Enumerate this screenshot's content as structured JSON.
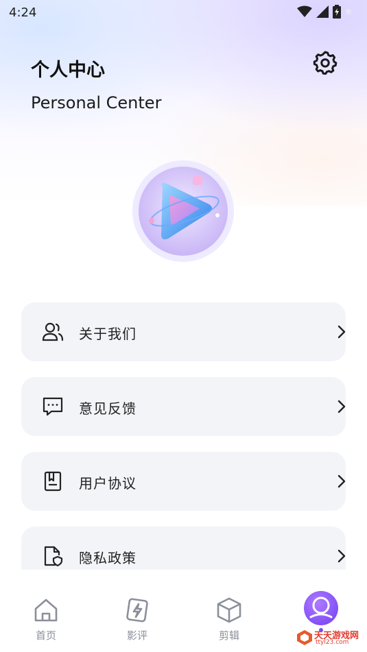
{
  "status_bar": {
    "time": "4:24"
  },
  "header": {
    "title": "个人中心",
    "subtitle": "Personal Center"
  },
  "menu": [
    {
      "label": "关于我们",
      "icon": "users-icon"
    },
    {
      "label": "意见反馈",
      "icon": "feedback-icon"
    },
    {
      "label": "用户协议",
      "icon": "agreement-icon"
    },
    {
      "label": "隐私政策",
      "icon": "privacy-icon"
    }
  ],
  "tabbar": {
    "items": [
      {
        "label": "首页",
        "icon": "home-icon"
      },
      {
        "label": "影评",
        "icon": "review-icon"
      },
      {
        "label": "剪辑",
        "icon": "cube-icon"
      },
      {
        "label": "",
        "icon": "profile-icon",
        "active": true
      }
    ]
  },
  "watermark": {
    "name": "天天游戏网",
    "url": "ttyl23.com"
  },
  "colors": {
    "accent": "#7a4cf7",
    "card_bg": "#f3f4f8",
    "inactive": "#8a8f9a"
  }
}
